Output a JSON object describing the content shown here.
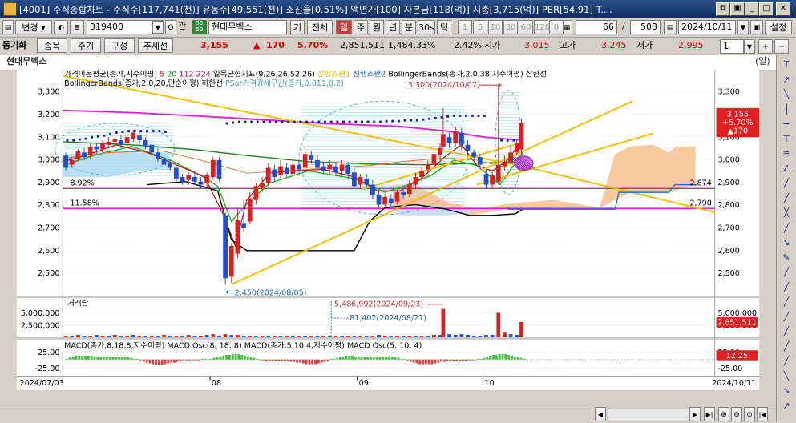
{
  "window": {
    "title": "[4001] 주식종합차트 - 주식수[117,741(천)] 유동주[49,551(천)] 소진율[0.51%] 액면가[100] 자본금[118(억)] 시총[3,715(억)] PER[54.91] T....",
    "buttons": [
      "⧉",
      "▣",
      "_",
      "□",
      "✕"
    ]
  },
  "toolbar1": {
    "menu_label": "변경",
    "code_value": "319400",
    "gwan_label": "관",
    "tag": "50\n50",
    "stock_name": "현대무벡스",
    "gi_label": "기",
    "all_label": "전체",
    "periods": [
      {
        "label": "일",
        "active": true
      },
      {
        "label": "주",
        "active": false
      },
      {
        "label": "월",
        "active": false
      },
      {
        "label": "년",
        "active": false
      },
      {
        "label": "분",
        "active": false
      },
      {
        "label": "30s",
        "active": false
      },
      {
        "label": "틱",
        "active": false
      }
    ],
    "intervals": [
      "1",
      "5",
      "10",
      "30",
      "60",
      "120",
      "0"
    ],
    "count_value": "66",
    "slash": "/",
    "total_value": "503",
    "date_value": "2024/10/11",
    "settings_label": "설정"
  },
  "toolbar2": {
    "sync_label": "동기화",
    "item_btn": "종목",
    "period_btn": "주기",
    "compose_btn": "구성",
    "trend_btn": "추세선",
    "price": "3,155",
    "change_arrow": "▲",
    "change": "170",
    "change_pct": "5.70%",
    "volume": "2,851,511",
    "vol_pct": "1,484.33%",
    "rate": "2.42%",
    "open_label": "시가",
    "open": "3,015",
    "high_label": "고가",
    "high": "3,245",
    "low_label": "저가",
    "low": "2,995",
    "page_value": "1"
  },
  "name_row": {
    "name": "현대무벡스",
    "unit": "(일)"
  },
  "price_pane": {
    "legend": [
      {
        "text": "가격이동평균(종가,지수이평)",
        "color": "#000000"
      },
      {
        "text": "5",
        "color": "#d00000"
      },
      {
        "text": "20",
        "color": "#00a000"
      },
      {
        "text": "112",
        "color": "#a000a0"
      },
      {
        "text": "224",
        "color": "#c00060"
      },
      {
        "text": "일목균형지표(9,26,26,52,26)",
        "color": "#000000"
      },
      {
        "text": "선행스팬1",
        "color": "#e0c000"
      },
      {
        "text": "선행스팬2",
        "color": "#2060c0"
      },
      {
        "text": "BollingerBands(종가,2,0.38,지수이평) 상한선",
        "color": "#000000"
      }
    ],
    "legend2": [
      {
        "text": "BollingerBands(종가,2,0,20,단순이평) 하한선",
        "color": "#000000"
      },
      {
        "text": "PSar가격강세구간(종가,0.011,0.2)",
        "color": "#40a0c0"
      }
    ],
    "y_ticks": [
      "3,300",
      "3,200",
      "3,100",
      "3,000",
      "2,900",
      "2,800",
      "2,700",
      "2,600",
      "2,500"
    ],
    "pct_labels": [
      "-8.92%",
      "-11.58%"
    ],
    "hi_annotation": "3,300(2024/10/07)",
    "lo_annotation": "2,450(2024/08/05)",
    "right_level_labels": [
      "2,874",
      "2,790"
    ],
    "current_price_box": [
      "3,155",
      "+5.70%",
      "▲170"
    ]
  },
  "volume_pane": {
    "legend": "거래량",
    "y_ticks": [
      "5,000,000",
      "2,500,000"
    ],
    "hi_annotation": "5,486,992(2024/09/23)",
    "lo_annotation": "81,402(2024/08/27)",
    "current_box": "2,851,511"
  },
  "macd_pane": {
    "legend": "MACD(종가,8,18,8,지수이평) MACD Osc(8, 18, 8) MACD(종가,5,10,4,지수이평) MACD Osc(5, 10, 4)",
    "y_ticks": [
      "25.00",
      "-25.00"
    ],
    "current_box": "12.25"
  },
  "x_axis": {
    "start": "2024/07/03",
    "end": "2024/10/11",
    "months": [
      "08",
      "09",
      "10"
    ]
  },
  "colors": {
    "up": "#d82020",
    "down": "#1f4fd0",
    "ma5": "#d00000",
    "ma20": "#20b020",
    "ma112": "#208020",
    "ma224": "#e020e0",
    "magenta_line": "#e000e0",
    "trend": "#f0c000"
  },
  "right_tools": [
    "T",
    "↗",
    "╲",
    "┃",
    "━",
    "⊤",
    "≋",
    "∠",
    "╱",
    "╱",
    "╳",
    "╱",
    "↘",
    "✎",
    "╱",
    "╱",
    "╱",
    "╱",
    "╱",
    "╱",
    "╱",
    "╲",
    "↘",
    "↗"
  ]
}
